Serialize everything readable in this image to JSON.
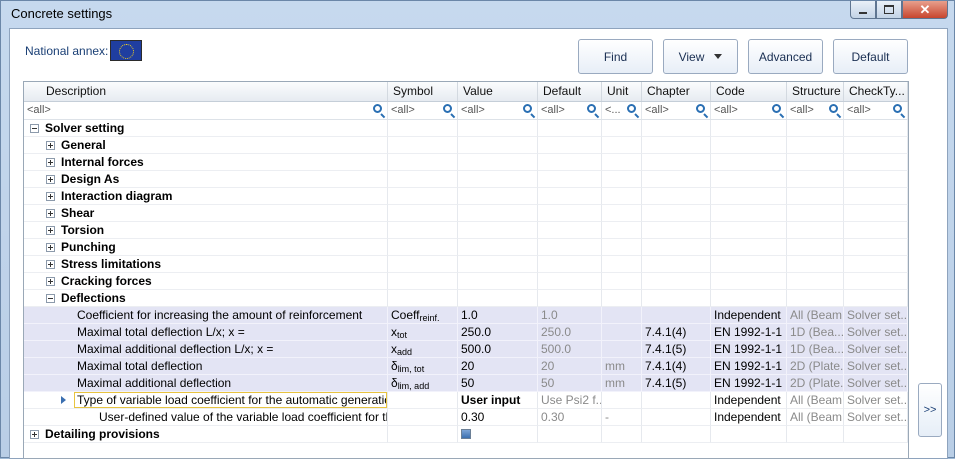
{
  "window": {
    "title": "Concrete settings"
  },
  "annex": {
    "label": "National annex:"
  },
  "toolbar": {
    "find": "Find",
    "view": "View",
    "advanced": "Advanced",
    "default": "Default"
  },
  "columns": [
    "Description",
    "Symbol",
    "Value",
    "Default",
    "Unit",
    "Chapter",
    "Code",
    "Structure",
    "CheckTy..."
  ],
  "filters": {
    "all": "<all>",
    "unit": "<..."
  },
  "tree": {
    "root": "Solver setting",
    "groups": [
      "General",
      "Internal forces",
      "Design As",
      "Interaction diagram",
      "Shear",
      "Torsion",
      "Punching",
      "Stress limitations",
      "Cracking forces"
    ],
    "deflections": "Deflections",
    "detailing": "Detailing provisions"
  },
  "rows": [
    {
      "desc": "Coefficient for increasing the amount of reinforcement",
      "sym": "Coeff",
      "sub": "reinf.",
      "value": "1.0",
      "default": "1.0",
      "unit": "",
      "chapter": "",
      "code": "Independent",
      "structure": "All (Beam...",
      "check": "Solver set..."
    },
    {
      "desc": "Maximal total deflection L/x; x =",
      "sym": "x",
      "sub": "tot",
      "value": "250.0",
      "default": "250.0",
      "unit": "",
      "chapter": "7.4.1(4)",
      "code": "EN 1992-1-1",
      "structure": "1D (Bea...",
      "check": "Solver set..."
    },
    {
      "desc": "Maximal additional deflection L/x; x =",
      "sym": "x",
      "sub": "add",
      "value": "500.0",
      "default": "500.0",
      "unit": "",
      "chapter": "7.4.1(5)",
      "code": "EN 1992-1-1",
      "structure": "1D (Bea...",
      "check": "Solver set..."
    },
    {
      "desc": "Maximal total deflection",
      "sym": "δ",
      "sub": "lim, tot",
      "value": "20",
      "default": "20",
      "unit": "mm",
      "chapter": "7.4.1(4)",
      "code": "EN 1992-1-1",
      "structure": "2D (Plate...",
      "check": "Solver set..."
    },
    {
      "desc": "Maximal additional deflection",
      "sym": "δ",
      "sub": "lim, add",
      "value": "50",
      "default": "50",
      "unit": "mm",
      "chapter": "7.4.1(5)",
      "code": "EN 1992-1-1",
      "structure": "2D (Plate...",
      "check": "Solver set..."
    },
    {
      "desc": "Type of variable load coefficient for the automatic generation of ...",
      "sym": "",
      "sub": "",
      "value": "User input",
      "default": "Use Psi2 f...",
      "unit": "",
      "chapter": "",
      "code": "Independent",
      "structure": "All (Beam...",
      "check": "Solver set..."
    },
    {
      "desc": "User-defined value of the variable load coefficient for the auto...",
      "sym": "",
      "sub": "",
      "value": "0.30",
      "default": "0.30",
      "unit": "-",
      "chapter": "",
      "code": "Independent",
      "structure": "All (Beam...",
      "check": "Solver set..."
    }
  ],
  "side_button": ">>"
}
